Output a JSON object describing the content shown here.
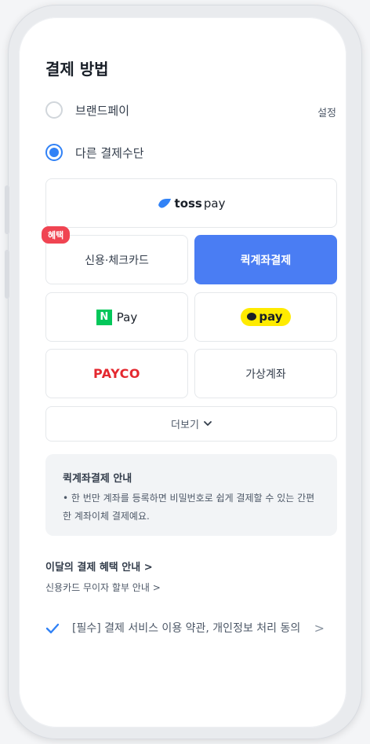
{
  "title": "결제 방법",
  "options": {
    "brandpay_label": "브랜드페이",
    "brandpay_setting": "설정",
    "other_label": "다른 결제수단"
  },
  "methods": {
    "tosspay_bold": "toss",
    "tosspay_light": "pay",
    "card": "신용·체크카드",
    "card_badge": "혜택",
    "quick_transfer": "퀵계좌결제",
    "npay_mark": "N",
    "npay_text": "Pay",
    "kakaopay": "pay",
    "payco": "PAYCO",
    "virtual_account": "가상계좌",
    "more": "더보기"
  },
  "info": {
    "title": "퀵계좌결제 안내",
    "text": "• 한 번만 계좌를 등록하면 비밀번호로 쉽게 결제할 수 있는 간편한 계좌이체 결제예요."
  },
  "links": {
    "benefits": "이달의 결제 혜택 안내 >",
    "installment": "신용카드 무이자 할부 안내 >"
  },
  "agreement": {
    "text": "[필수] 결제 서비스 이용 약관, 개인정보 처리 동의",
    "chevron": ">",
    "checked": true
  },
  "colors": {
    "accent": "#3182f6",
    "selected_method": "#4a7df3",
    "badge": "#f04452",
    "npay": "#03c75a",
    "kakaopay": "#ffeb00",
    "payco": "#e4282f"
  }
}
